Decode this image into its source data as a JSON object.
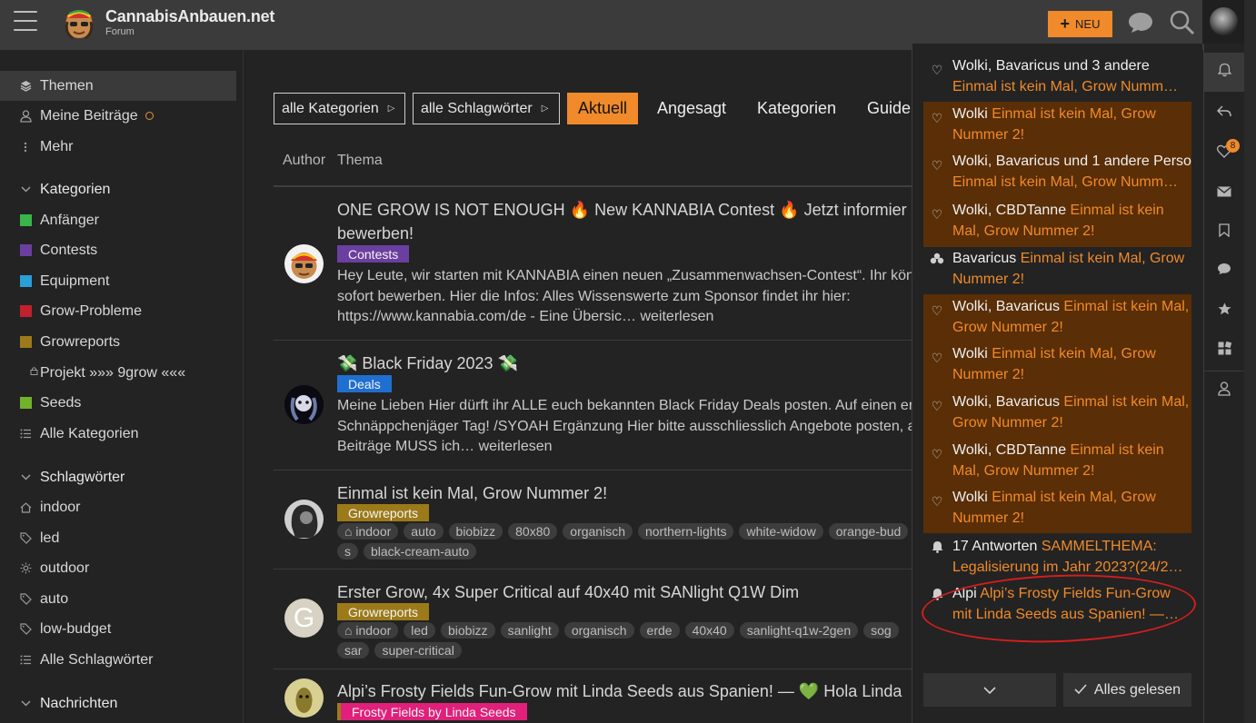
{
  "site": {
    "title": "CannabisAnbauen.net",
    "subtitle": "Forum"
  },
  "header": {
    "new_label": "NEU"
  },
  "sidebar": {
    "items": [
      {
        "label": "Themen"
      },
      {
        "label": "Meine Beiträge"
      },
      {
        "label": "Mehr"
      }
    ],
    "categories_title": "Kategorien",
    "categories": [
      {
        "label": "Anfänger",
        "color": "#3ab54a"
      },
      {
        "label": "Contests",
        "color": "#6b3fa0"
      },
      {
        "label": "Equipment",
        "color": "#2a9fd8"
      },
      {
        "label": "Grow-Probleme",
        "color": "#c0212d"
      },
      {
        "label": "Growreports",
        "color": "#9c7a1a"
      },
      {
        "label": "Projekt »»» 9grow «««"
      },
      {
        "label": "Seeds",
        "color": "#72b22b"
      },
      {
        "label": "Alle Kategorien"
      }
    ],
    "tags_title": "Schlagwörter",
    "tags": [
      {
        "label": "indoor"
      },
      {
        "label": "led"
      },
      {
        "label": "outdoor"
      },
      {
        "label": "auto"
      },
      {
        "label": "low-budget"
      },
      {
        "label": "Alle Schlagwörter"
      }
    ],
    "messages_title": "Nachrichten"
  },
  "filters": {
    "category": "alle Kategorien",
    "tags": "alle Schlagwörter"
  },
  "nav": {
    "aktuell": "Aktuell",
    "angesagt": "Angesagt",
    "kategorien": "Kategorien",
    "guide": "Guide"
  },
  "columns": {
    "author": "Author",
    "topic": "Thema"
  },
  "topics": [
    {
      "title_line1": "ONE GROW IS NOT ENOUGH 🔥 New KANNABIA Contest 🔥 Jetzt informier",
      "title_line2": "bewerben!",
      "category": "Contests",
      "category_color": "#6b3fa0",
      "excerpt_1": "Hey Leute, wir starten mit KANNABIA einen neuen „Zusammenwachsen-Contest“. Ihr kön",
      "excerpt_2": "sofort bewerben. Hier die Infos: Alles Wissenswerte zum Sponsor findet ihr hier:",
      "excerpt_3": "https://www.kannabia.com/de - Eine Übersic… weiterlesen"
    },
    {
      "title_line1": "💸 Black Friday 2023 💸",
      "category": "Deals",
      "category_color": "#1f6fd0",
      "excerpt_1": "Meine Lieben Hier dürft ihr ALLE euch bekannten Black Friday Deals posten. Auf einen er",
      "excerpt_2": "Schnäppchenjäger Tag! /SYOAH Ergänzung Hier bitte ausschliesslich Angebote posten, a",
      "excerpt_3": "Beiträge MUSS ich… weiterlesen"
    },
    {
      "title_line1": "Einmal ist kein Mal, Grow Nummer 2!",
      "category": "Growreports",
      "category_color": "#9c7a1a",
      "tags": [
        "indoor",
        "auto",
        "biobizz",
        "80x80",
        "organisch",
        "northern-lights",
        "white-widow",
        "orange-bud",
        "s",
        "black-cream-auto"
      ]
    },
    {
      "title_line1": "Erster Grow, 4x Super Critical auf 40x40 mit SANlight Q1W Dim",
      "category": "Growreports",
      "category_color": "#9c7a1a",
      "avatar_letter": "G",
      "tags": [
        "indoor",
        "led",
        "biobizz",
        "sanlight",
        "organisch",
        "erde",
        "40x40",
        "sanlight-q1w-2gen",
        "sog",
        "sar",
        "super-critical"
      ]
    },
    {
      "title_line1": "Alpi’s Frosty Fields Fun-Grow mit Linda Seeds aus Spanien! — 💚 Hola Linda",
      "category": "Frosty Fields by Linda Seeds",
      "category_color": "#e0207a"
    }
  ],
  "notifications": [
    {
      "who": "Wolki, Bavaricus und 3 andere",
      "what": "Einmal ist kein Mal, Grow Numm…",
      "icon": "heart-icon",
      "unread": false
    },
    {
      "who": "Wolki",
      "what": "Einmal ist kein Mal, Grow Nummer 2!",
      "icon": "heart-icon",
      "unread": true
    },
    {
      "who": "Wolki, Bavaricus und 1 andere Perso",
      "what": "Einmal ist kein Mal, Grow Numm…",
      "icon": "heart-icon",
      "unread": true
    },
    {
      "who": "Wolki, CBDTanne",
      "what": "Einmal ist kein Mal, Grow Nummer 2!",
      "icon": "heart-icon",
      "unread": true
    },
    {
      "who": "Bavaricus",
      "what": "Einmal ist kein Mal, Grow Nummer 2!",
      "icon": "badge-icon",
      "unread": false
    },
    {
      "who": "Wolki, Bavaricus",
      "what": "Einmal ist kein Mal, Grow Nummer 2!",
      "icon": "heart-icon",
      "unread": true
    },
    {
      "who": "Wolki",
      "what": "Einmal ist kein Mal, Grow Nummer 2!",
      "icon": "heart-icon",
      "unread": true
    },
    {
      "who": "Wolki, Bavaricus",
      "what": "Einmal ist kein Mal, Grow Nummer 2!",
      "icon": "heart-icon",
      "unread": true
    },
    {
      "who": "Wolki, CBDTanne",
      "what": "Einmal ist kein Mal, Grow Nummer 2!",
      "icon": "heart-icon",
      "unread": true
    },
    {
      "who": "Wolki",
      "what": "Einmal ist kein Mal, Grow Nummer 2!",
      "icon": "heart-icon",
      "unread": true
    },
    {
      "who": "17 Antworten",
      "what": "SAMMELTHEMA: Legalisierung im Jahr 2023?(24/2…",
      "icon": "bell-icon",
      "unread": false
    },
    {
      "who": "Alpi",
      "what": "Alpi’s Frosty Fields Fun-Grow mit Linda Seeds aus Spanien! —…",
      "icon": "bell-icon",
      "unread": false
    }
  ],
  "panel_footer": {
    "mark_read": "Alles gelesen"
  },
  "rail": {
    "likes_badge": "8"
  },
  "colors": {
    "accent": "#f08a2a",
    "unread_bg": "#5a2e06",
    "bg": "#232323"
  }
}
